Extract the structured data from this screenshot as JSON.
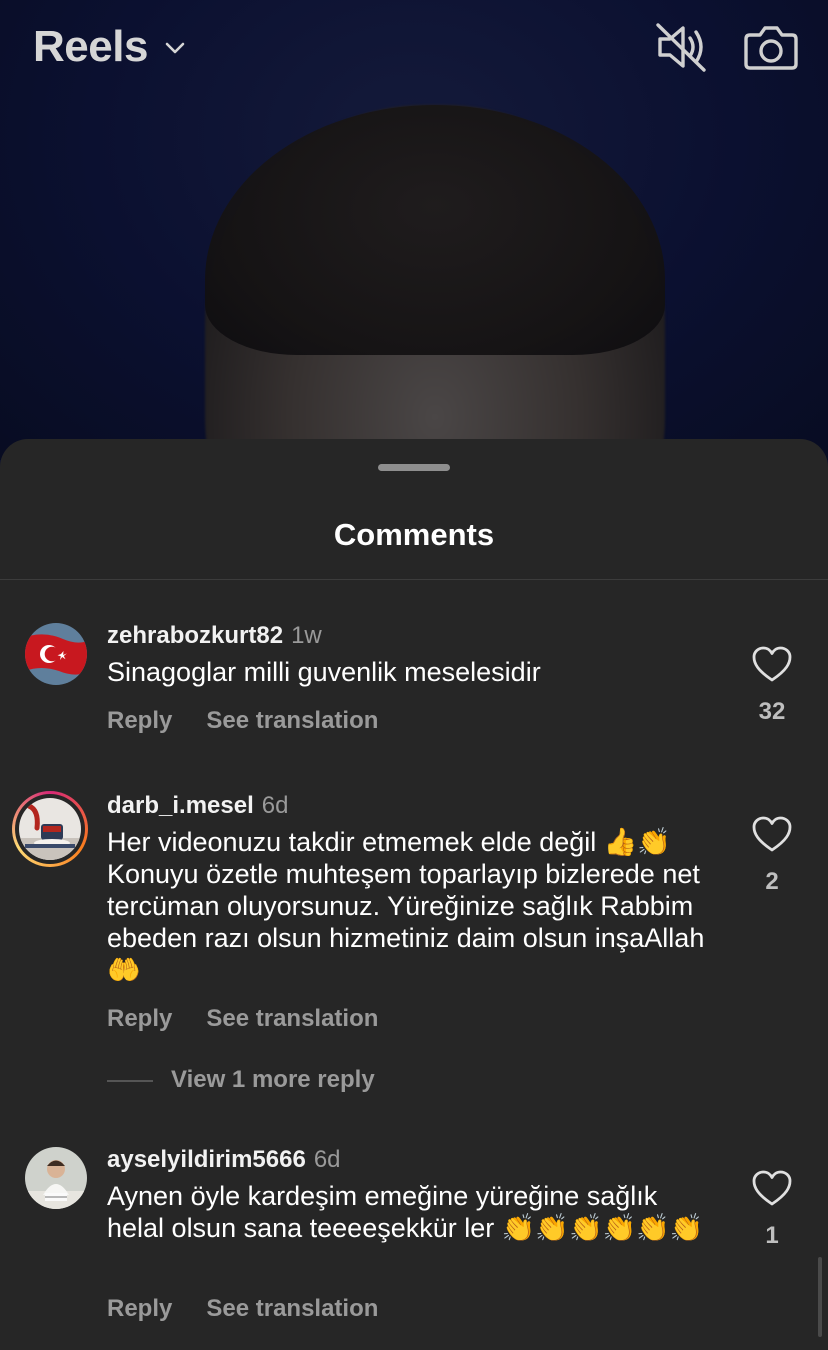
{
  "header": {
    "title": "Reels",
    "chevron_icon": "chevron-down-icon",
    "mute_icon": "speaker-muted-icon",
    "camera_icon": "camera-icon"
  },
  "sheet": {
    "title": "Comments"
  },
  "comments": [
    {
      "username": "zehrabozkurt82",
      "time": "1w",
      "text": "Sinagoglar milli guvenlik meselesidir",
      "reply_label": "Reply",
      "translate_label": "See translation",
      "likes": "32"
    },
    {
      "username": "darb_i.mesel",
      "time": "6d",
      "text": "Her videonuzu takdir etmemek elde değil 👍👏Konuyu özetle muhteşem toparlayıp bizlerede net tercüman oluyorsunuz. Yüreğinize sağlık Rabbim ebeden razı olsun hizmetiniz daim olsun inşaAllah 🤲",
      "reply_label": "Reply",
      "translate_label": "See translation",
      "likes": "2",
      "view_replies": "View 1 more reply"
    },
    {
      "username": "ayselyildirim5666",
      "time": "6d",
      "text": "Aynen öyle kardeşim emeğine yüreğine sağlık helal olsun sana teeeeşekkür ler 👏👏👏👏👏👏",
      "reply_label": "Reply",
      "translate_label": "See translation",
      "likes": "1"
    }
  ],
  "colors": {
    "sheet_bg": "#262626",
    "secondary_text": "#9a9a9a",
    "video_bg": "#0d1230"
  }
}
